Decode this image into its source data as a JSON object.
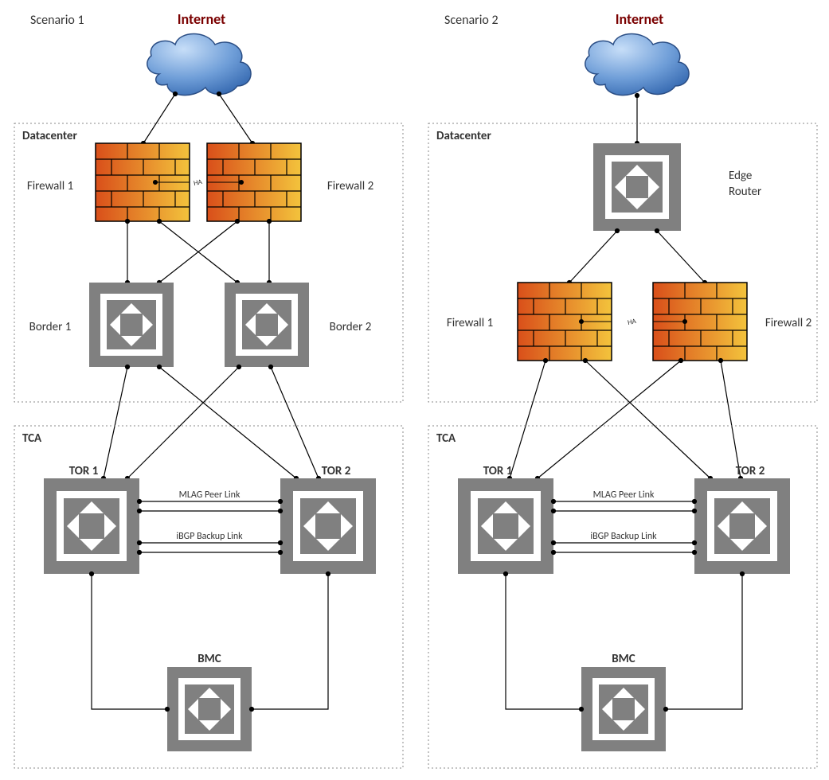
{
  "labels": {
    "scenario1": "Scenario 1",
    "scenario2": "Scenario 2",
    "internet": "Internet",
    "datacenter": "Datacenter",
    "tca": "TCA",
    "firewall1": "Firewall 1",
    "firewall2": "Firewall 2",
    "border1": "Border 1",
    "border2": "Border 2",
    "edge_router": "Edge Router",
    "tor1": "TOR 1",
    "tor2": "TOR 2",
    "mlag": "MLAG Peer Link",
    "ibgp": "iBGP Backup Link",
    "bmc": "BMC",
    "ha": "HA"
  },
  "colors": {
    "internet_text": "#7a0000",
    "text": "#333333",
    "box_border": "#8a8a8a",
    "router_fill": "#808080",
    "router_arrow": "#ffffff",
    "firewall_dark": "#d65a1f",
    "firewall_light": "#f6b93b",
    "cloud_top": "#5a8fd6",
    "cloud_bot": "#b7d4f5",
    "line": "#000000"
  }
}
